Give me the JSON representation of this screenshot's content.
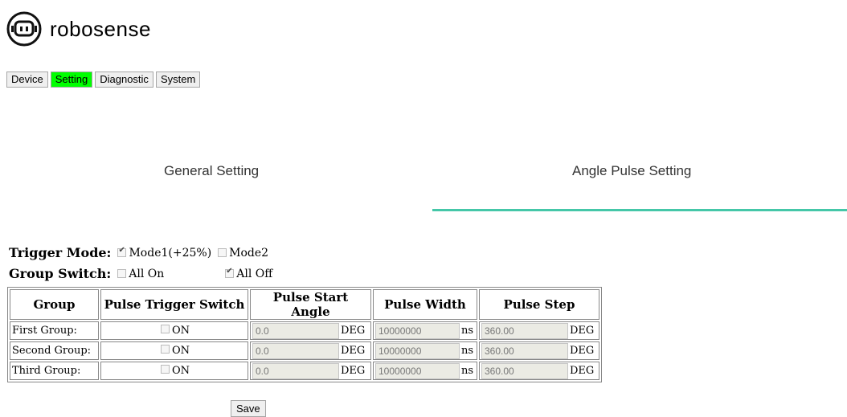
{
  "brand": {
    "name": "robosense",
    "accent": "#45c7a8",
    "active_tab_color": "#00ff00"
  },
  "nav": {
    "items": [
      "Device",
      "Setting",
      "Diagnostic",
      "System"
    ],
    "active": "Setting"
  },
  "section_tabs": {
    "general": "General Setting",
    "angle": "Angle Pulse Setting",
    "active": "Angle Pulse Setting"
  },
  "trigger_mode": {
    "label": "Trigger Mode:",
    "mode1": "Mode1(+25%)",
    "mode1_checked": true,
    "mode2": "Mode2",
    "mode2_checked": false
  },
  "group_switch": {
    "label": "Group Switch:",
    "all_on": "All On",
    "all_on_checked": false,
    "all_off": "All Off",
    "all_off_checked": true
  },
  "table": {
    "headers": [
      "Group",
      "Pulse Trigger Switch",
      "Pulse Start Angle",
      "Pulse Width",
      "Pulse Step"
    ],
    "rows": [
      {
        "group": "First Group:",
        "switch": "ON",
        "start": "0.0",
        "start_unit": "DEG",
        "width": "10000000",
        "width_unit": "ns",
        "step": "360.00",
        "step_unit": "DEG"
      },
      {
        "group": "Second Group:",
        "switch": "ON",
        "start": "0.0",
        "start_unit": "DEG",
        "width": "10000000",
        "width_unit": "ns",
        "step": "360.00",
        "step_unit": "DEG"
      },
      {
        "group": "Third Group:",
        "switch": "ON",
        "start": "0.0",
        "start_unit": "DEG",
        "width": "10000000",
        "width_unit": "ns",
        "step": "360.00",
        "step_unit": "DEG"
      }
    ]
  },
  "save_label": "Save"
}
